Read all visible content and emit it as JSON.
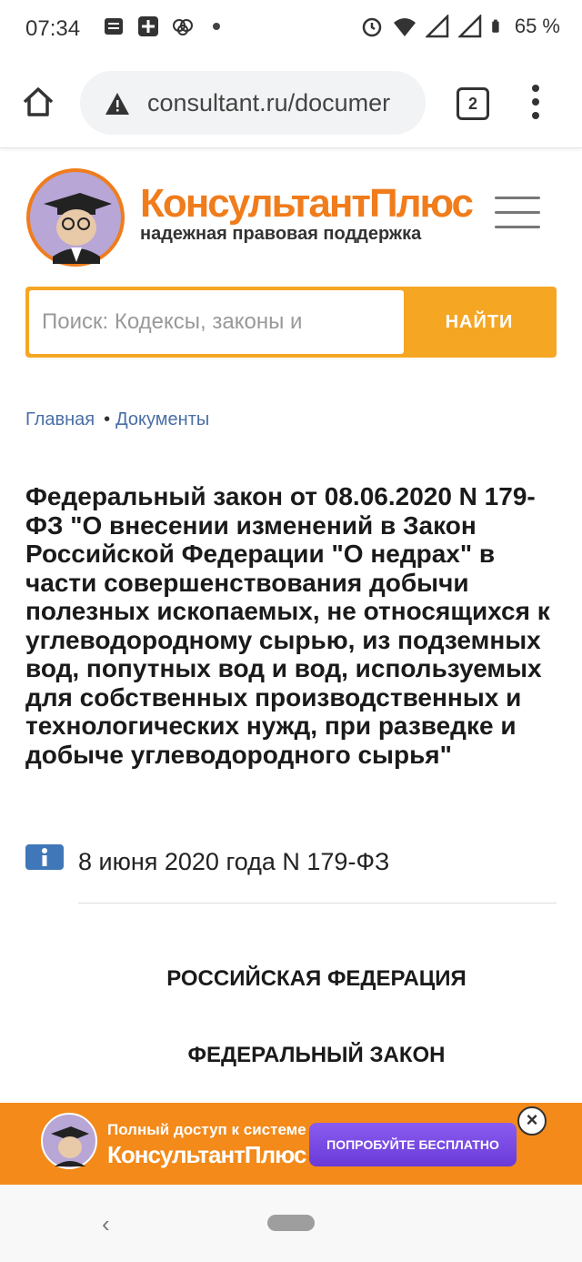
{
  "status_bar": {
    "time": "07:34",
    "battery": "65 %",
    "icons_left": [
      "message-icon",
      "app-icon",
      "brain-icon",
      "dot-icon"
    ],
    "icons_right": [
      "alarm-icon",
      "wifi-icon",
      "signal-icon",
      "signal-icon",
      "battery-icon"
    ]
  },
  "browser": {
    "url": "consultant.ru/documer",
    "tab_count": "2"
  },
  "header": {
    "brand_name": "КонсультантПлюс",
    "brand_sub": "надежная правовая поддержка"
  },
  "search": {
    "placeholder": "Поиск: Кодексы, законы и",
    "button_label": "НАЙТИ"
  },
  "breadcrumb": {
    "items": [
      "Главная",
      "Документы"
    ],
    "separator": "•"
  },
  "document": {
    "title": "Федеральный закон от 08.06.2020 N 179-ФЗ \"О внесении изменений в Закон Российской Федерации \"О недрах\" в части совершенствования добычи полезных ископаемых, не относящихся к углеводородному сырью, из подземных вод, попутных вод и вод, используемых для собственных производственных и технологических нужд, при разведке и добыче углеводородного сырья\"",
    "date_line": "8 июня 2020 года N 179-ФЗ",
    "heading1": "РОССИЙСКАЯ ФЕДЕРАЦИЯ",
    "heading2": "ФЕДЕРАЛЬНЫЙ ЗАКОН"
  },
  "banner": {
    "line1": "Полный доступ к системе",
    "line2": "КонсультантПлюс",
    "button": "ПОПРОБУЙТЕ БЕСПЛАТНО",
    "close": "×"
  },
  "navbar": {
    "back": "‹"
  },
  "colors": {
    "brand_orange": "#f07c1c",
    "search_orange": "#f5a623",
    "banner_orange": "#f38a1a",
    "link_blue": "#4a6fa5",
    "button_purple": "#7a4ae6"
  }
}
